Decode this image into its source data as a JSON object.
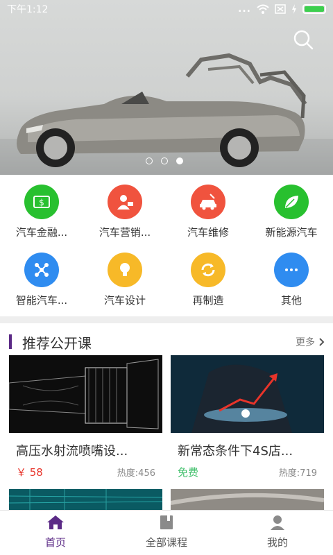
{
  "status_bar": {
    "time": "下午1:12",
    "dots": "..."
  },
  "banner": {
    "page_count": 3,
    "active_page": 3,
    "search_icon": "search-icon"
  },
  "categories": [
    {
      "label": "汽车金融...",
      "icon": "money-icon",
      "color": "#28c02f"
    },
    {
      "label": "汽车营销...",
      "icon": "salesperson-icon",
      "color": "#f0533e"
    },
    {
      "label": "汽车维修",
      "icon": "car-repair-icon",
      "color": "#f0533e"
    },
    {
      "label": "新能源汽车",
      "icon": "leaf-icon",
      "color": "#28c02f"
    },
    {
      "label": "智能汽车...",
      "icon": "network-icon",
      "color": "#2f8cf0"
    },
    {
      "label": "汽车设计",
      "icon": "lightbulb-icon",
      "color": "#f7b928"
    },
    {
      "label": "再制造",
      "icon": "recycle-icon",
      "color": "#f7b928"
    },
    {
      "label": "其他",
      "icon": "more-icon",
      "color": "#2f8cf0"
    }
  ],
  "section": {
    "title": "推荐公开课",
    "more": "更多"
  },
  "courses": [
    {
      "title": "高压水射流喷嘴设...",
      "price": "￥ 58",
      "heat": "热度:456"
    },
    {
      "title": "新常态条件下4S店...",
      "price": "免费",
      "heat": "热度:719"
    }
  ],
  "tabbar": [
    {
      "label": "首页",
      "icon": "home-icon",
      "active": true
    },
    {
      "label": "全部课程",
      "icon": "book-icon",
      "active": false
    },
    {
      "label": "我的",
      "icon": "user-icon",
      "active": false
    }
  ],
  "colors": {
    "accent": "#5b2a86",
    "price": "#e8342a",
    "free": "#3fbf6a"
  }
}
